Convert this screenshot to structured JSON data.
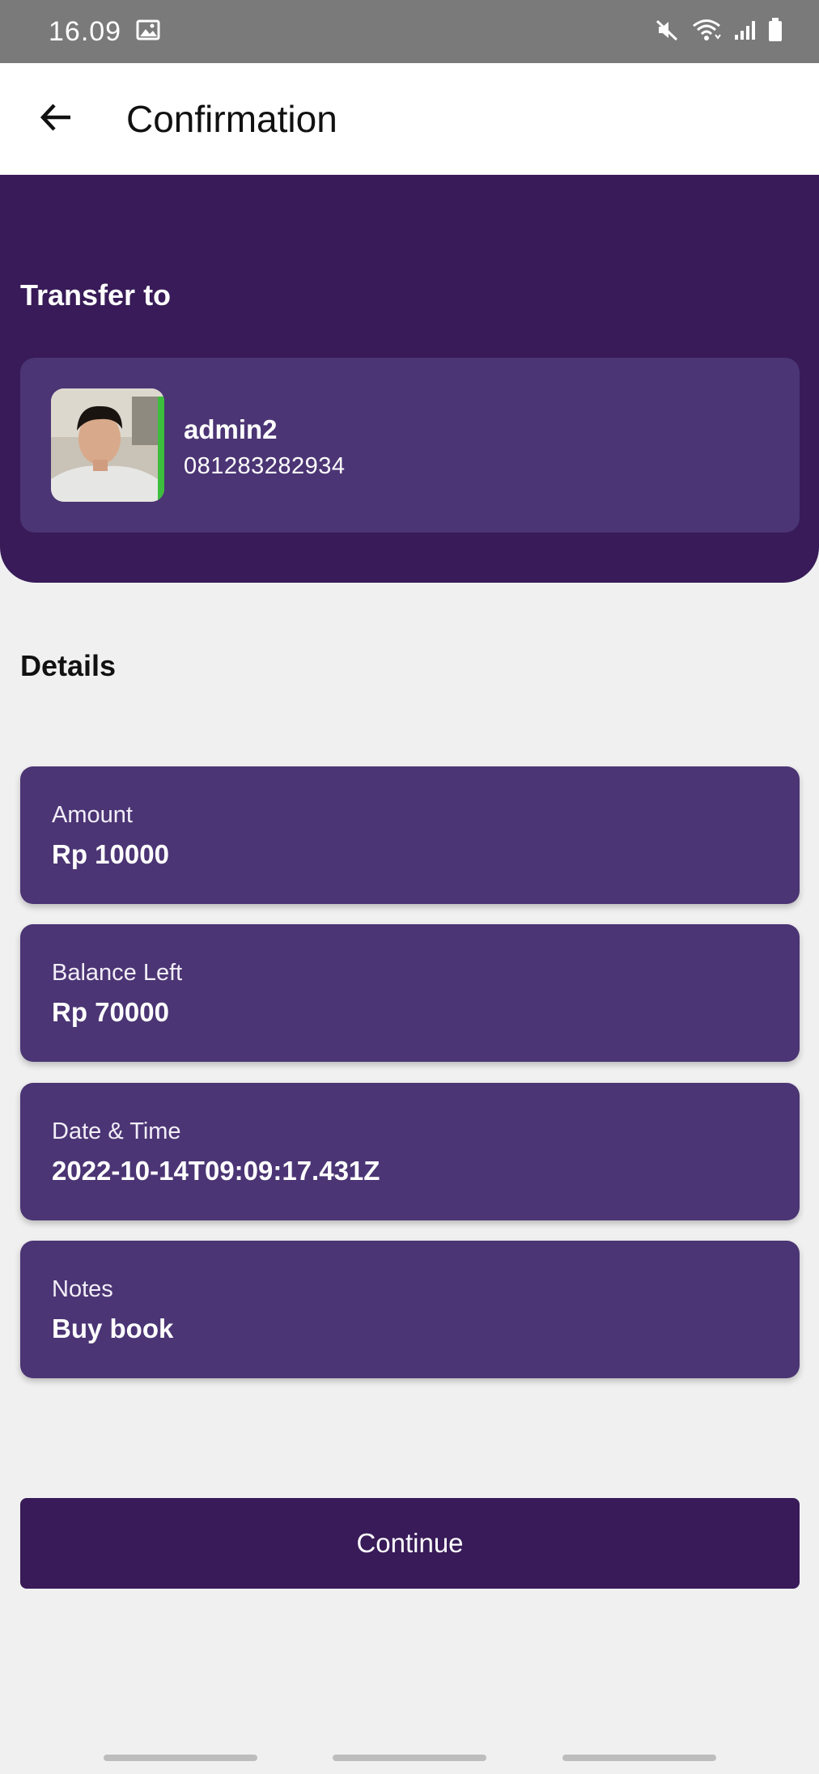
{
  "status_bar": {
    "time": "16.09",
    "icons": [
      "image-icon",
      "mute-icon",
      "wifi-icon",
      "signal-icon",
      "battery-icon"
    ]
  },
  "app_bar": {
    "back_icon": "arrow-left-icon",
    "title": "Confirmation"
  },
  "transfer": {
    "heading": "Transfer to",
    "recipient": {
      "name": "admin2",
      "phone": "081283282934"
    }
  },
  "details": {
    "heading": "Details",
    "items": [
      {
        "label": "Amount",
        "value": "Rp 10000"
      },
      {
        "label": "Balance Left",
        "value": "Rp 70000"
      },
      {
        "label": "Date & Time",
        "value": "2022-10-14T09:09:17.431Z"
      },
      {
        "label": "Notes",
        "value": "Buy book"
      }
    ]
  },
  "actions": {
    "continue_label": "Continue"
  },
  "colors": {
    "primary_dark": "#381b58",
    "card_purple": "#4b3574",
    "background": "#f0f0f0",
    "status_bar": "#7a7a7a"
  }
}
